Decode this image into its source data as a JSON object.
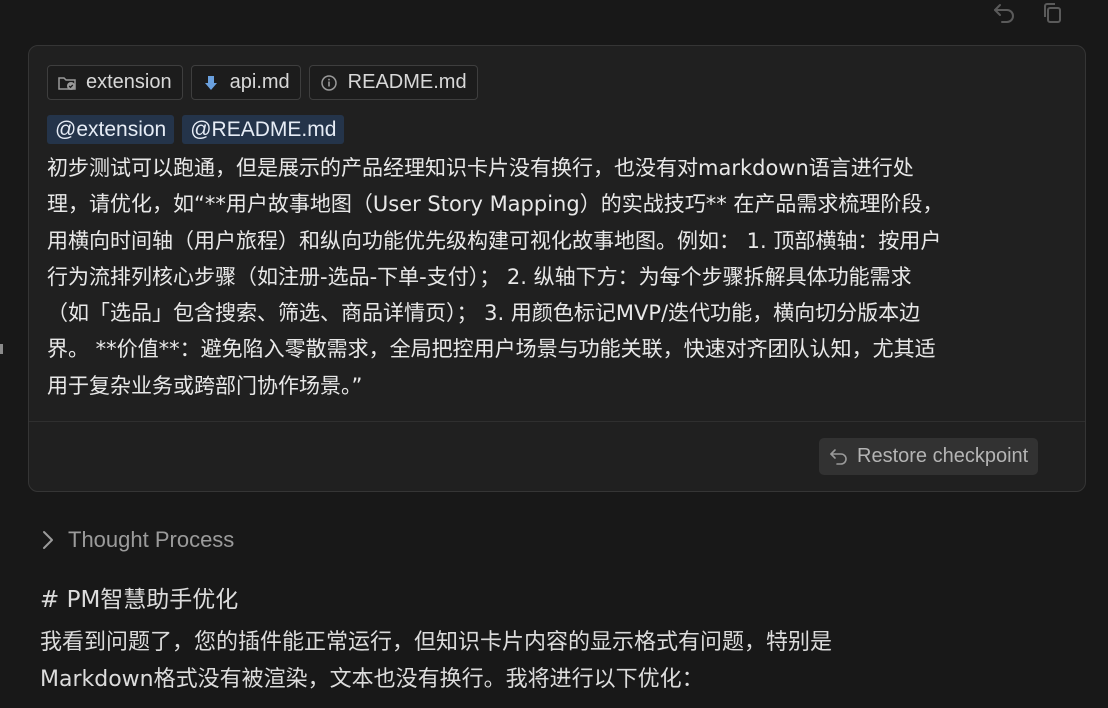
{
  "toolbar": {
    "undo_icon": "undo-icon",
    "copy_icon": "copy-icon"
  },
  "composer": {
    "context_chips": [
      {
        "icon": "folder-check-icon",
        "label": "extension"
      },
      {
        "icon": "download-arrow-icon",
        "label": "api.md"
      },
      {
        "icon": "info-icon",
        "label": "README.md"
      }
    ],
    "mentions": [
      "@extension",
      "@README.md"
    ],
    "message_lines": [
      "初步测试可以跑通，但是展示的产品经理知识卡片没有换行，也没有对markdown语言进行处",
      "理，请优化，如“**用户故事地图（User Story Mapping）的实战技巧** 在产品需求梳理阶段，",
      "用横向时间轴（用户旅程）和纵向功能优先级构建可视化故事地图。例如： 1. 顶部横轴：按用户",
      "行为流排列核心步骤（如注册-选品-下单-支付）； 2. 纵轴下方：为每个步骤拆解具体功能需求",
      "（如「选品」包含搜索、筛选、商品详情页）； 3. 用颜色标记MVP/迭代功能，横向切分版本边",
      "界。 **价值**：避免陷入零散需求，全局把控用户场景与功能关联，快速对齐团队认知，尤其适",
      "用于复杂业务或跨部门协作场景。”"
    ],
    "restore_label": "Restore checkpoint"
  },
  "response": {
    "thought_label": "Thought Process",
    "heading": "# PM智慧助手优化",
    "paragraph_lines": [
      "我看到问题了，您的插件能正常运行，但知识卡片内容的显示格式有问题，特别是",
      "Markdown格式没有被渲染，文本也没有换行。我将进行以下优化："
    ]
  }
}
